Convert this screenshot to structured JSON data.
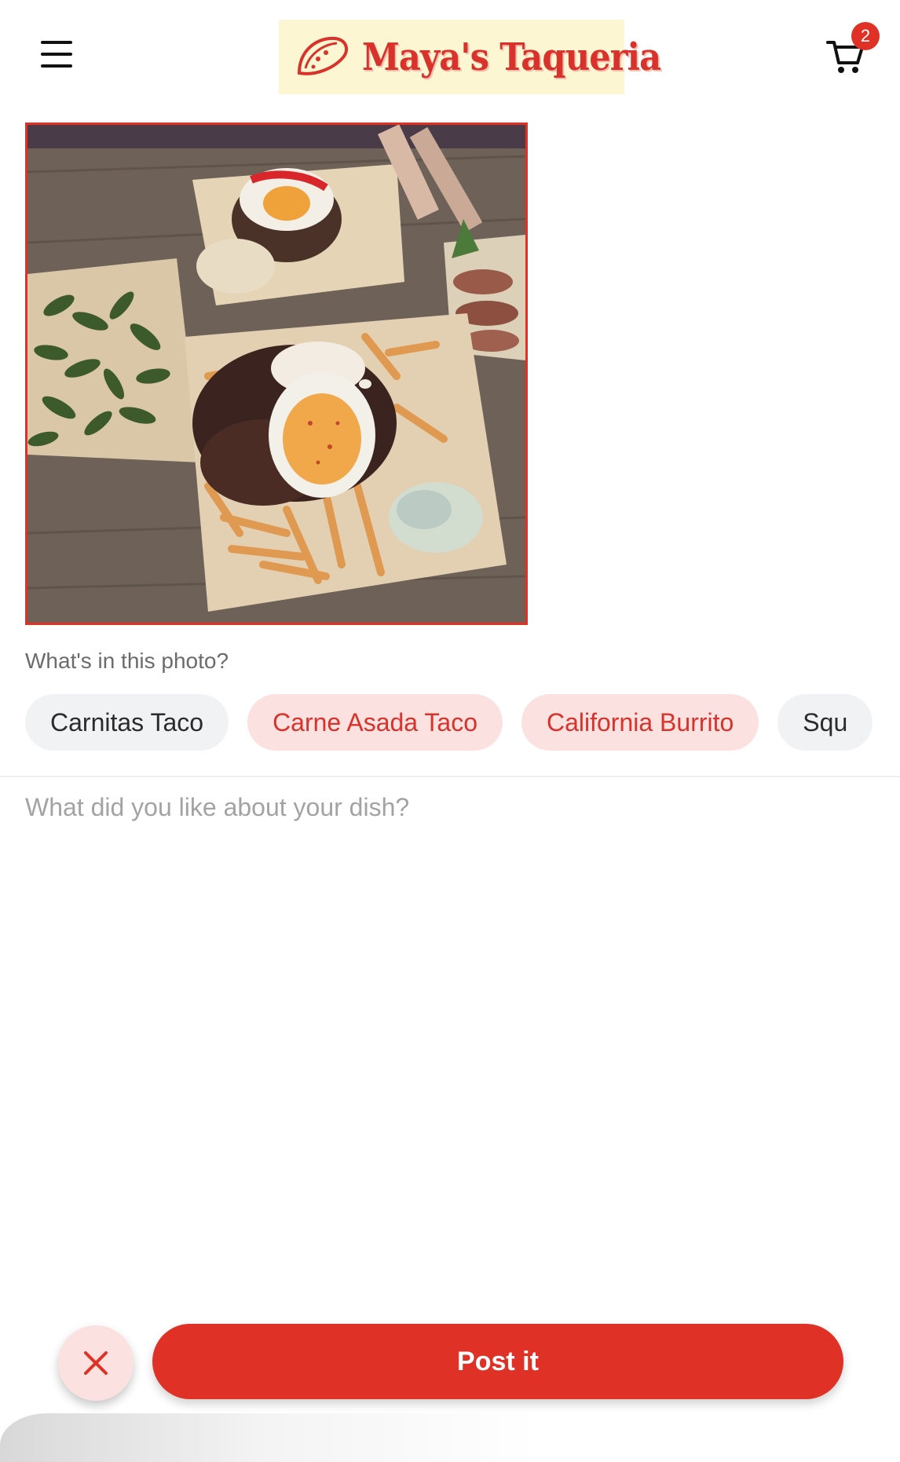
{
  "header": {
    "menu_icon": "hamburger-menu-icon",
    "logo": {
      "text": "Maya's Taqueria",
      "icon": "taco-icon",
      "bg_color": "#fdf6d3",
      "text_color": "#d9322b"
    },
    "cart": {
      "icon": "shopping-cart-icon",
      "badge_count": "2"
    }
  },
  "photo": {
    "description_alt": "Food photo",
    "border_color": "#e03127"
  },
  "tagging": {
    "question": "What's in this photo?",
    "chips": [
      {
        "label": "Carnitas Taco",
        "selected": false
      },
      {
        "label": "Carne Asada Taco",
        "selected": true
      },
      {
        "label": "California Burrito",
        "selected": true
      },
      {
        "label": "Squ",
        "selected": false
      }
    ]
  },
  "comment": {
    "placeholder": "What did you like about your dish?",
    "value": ""
  },
  "actions": {
    "cancel_icon": "close-icon",
    "post_label": "Post it",
    "accent_color": "#e03127"
  }
}
